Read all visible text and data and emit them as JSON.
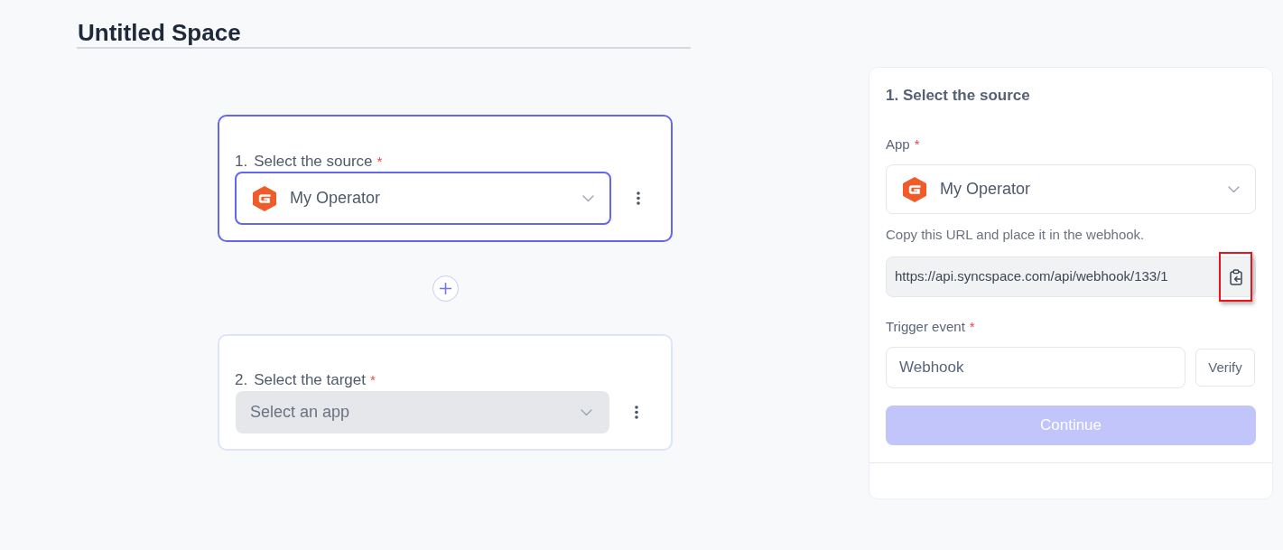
{
  "page": {
    "title": "Untitled Space"
  },
  "steps": [
    {
      "number": "1.",
      "label": "Select the source",
      "required_mark": "*",
      "selected": true,
      "app": {
        "name": "My Operator"
      }
    },
    {
      "number": "2.",
      "label": "Select the target",
      "required_mark": "*",
      "selected": false,
      "placeholder": "Select an app"
    }
  ],
  "panel": {
    "title": "1. Select the source",
    "app_field": {
      "label": "App",
      "required_mark": "*",
      "value": "My Operator"
    },
    "hint": "Copy this URL and place it in the webhook.",
    "webhook_url": {
      "value": "https://api.syncspace.com/api/webhook/133/1",
      "copy_highlighted": true
    },
    "trigger_field": {
      "label": "Trigger event",
      "required_mark": "*",
      "value": "Webhook"
    },
    "verify_button": {
      "label": "Verify"
    },
    "continue_button": {
      "label": "Continue",
      "disabled": true
    }
  }
}
